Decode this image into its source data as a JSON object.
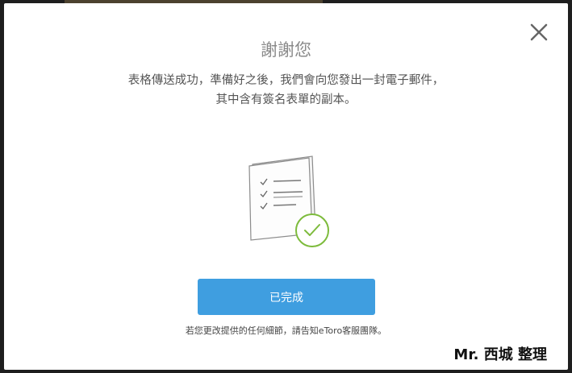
{
  "dialog": {
    "title": "謝謝您",
    "message_lines": [
      "表格傳送成功，準備好之後，我們會向您發出一封電子郵件，",
      "其中含有簽名表單的副本。"
    ],
    "done_button": "已完成",
    "footnote": "若您更改提供的任何細節，請告知eToro客服團隊。",
    "close_icon": "close-icon"
  },
  "watermark": "Mr. 西城 整理",
  "colors": {
    "primary_button": "#3f9ee0",
    "success_check": "#7dbb3c",
    "title_text": "#8a8a8a"
  }
}
